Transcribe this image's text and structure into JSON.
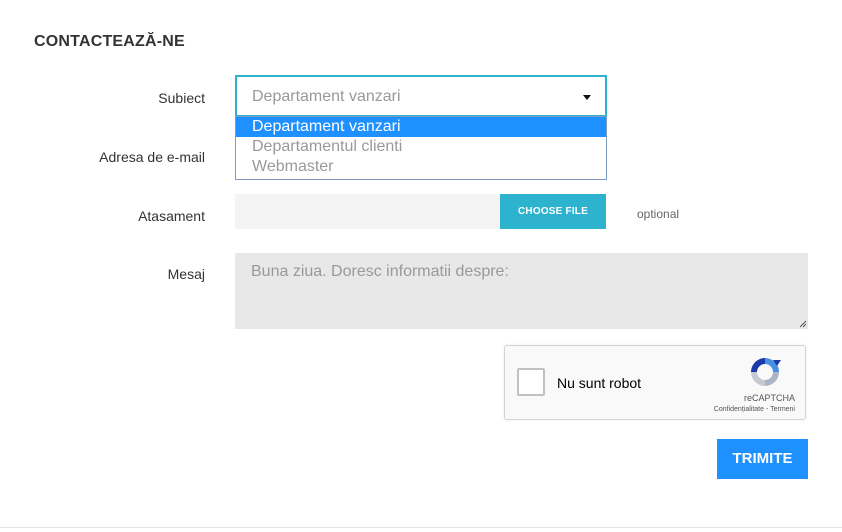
{
  "form": {
    "title": "CONTACTEAZĂ-NE",
    "subject": {
      "label": "Subiect",
      "selected": "Departament vanzari",
      "options": [
        "Departament vanzari",
        "Departamentul clienti",
        "Webmaster"
      ]
    },
    "email": {
      "label": "Adresa de e-mail"
    },
    "attachment": {
      "label": "Atasament",
      "button": "CHOOSE FILE",
      "hint": "optional"
    },
    "message": {
      "label": "Mesaj",
      "placeholder": "Buna ziua. Doresc informatii despre:"
    },
    "captcha": {
      "label": "Nu sunt robot",
      "brand": "reCAPTCHA",
      "links": "Confidențialitate - Termeni"
    },
    "submit": "TRIMITE"
  },
  "colors": {
    "accent": "#2eb3cf",
    "primary": "#1e90ff"
  }
}
